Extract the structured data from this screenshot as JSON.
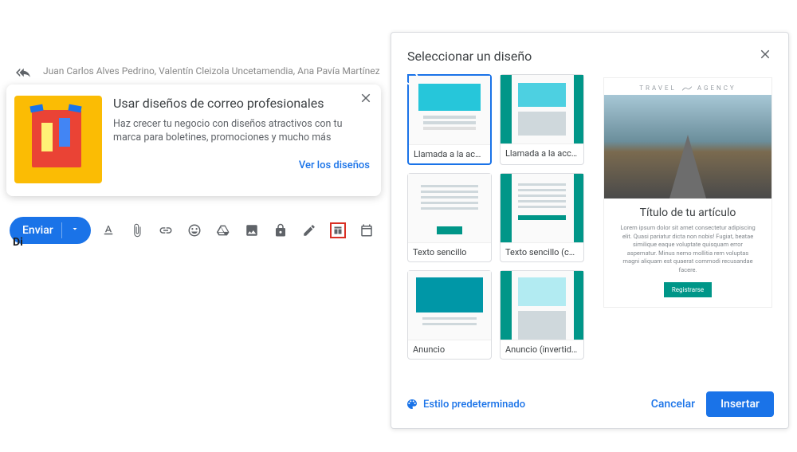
{
  "compose": {
    "recipients": "Juan Carlos Alves Pedrino, Valentín Cleizola Uncetamendia, Ana Pavía Martínez",
    "truncated": "Di",
    "toolbar": {
      "send": "Enviar"
    }
  },
  "promo": {
    "title": "Usar diseños de correo profesionales",
    "body": "Haz crecer tu negocio con diseños atractivos con tu marca para boletines, promociones y mucho más",
    "cta": "Ver los diseños"
  },
  "dialog": {
    "title": "Seleccionar un diseño",
    "templates": [
      {
        "label": "Llamada a la acción",
        "selected": true,
        "variant": "t-cta"
      },
      {
        "label": "Llamada a la acci...",
        "selected": false,
        "variant": "t-cta-cols"
      },
      {
        "label": "Texto sencillo",
        "selected": false,
        "variant": "t-text"
      },
      {
        "label": "Texto sencillo (col...",
        "selected": false,
        "variant": "t-text-cols"
      },
      {
        "label": "Anuncio",
        "selected": false,
        "variant": "t-ann"
      },
      {
        "label": "Anuncio (invertido)",
        "selected": false,
        "variant": "t-ann-cols"
      }
    ],
    "preview": {
      "brand1": "TRAVEL",
      "brand2": "AGENCY",
      "title": "Título de tu artículo",
      "lorem": "Lorem ipsum dolor sit amet consectetur adipiscing elit. Quasi pariatur dicta non nobis! Fugiat, beatae similique eaque voluptate quisquam error aspernatur. Minus nemo mollitia rem voluptas magni aliquam est quaerat commodi recusandae facere.",
      "cta": "Registrarse"
    },
    "footer": {
      "style": "Estilo predeterminado",
      "cancel": "Cancelar",
      "insert": "Insertar"
    }
  }
}
